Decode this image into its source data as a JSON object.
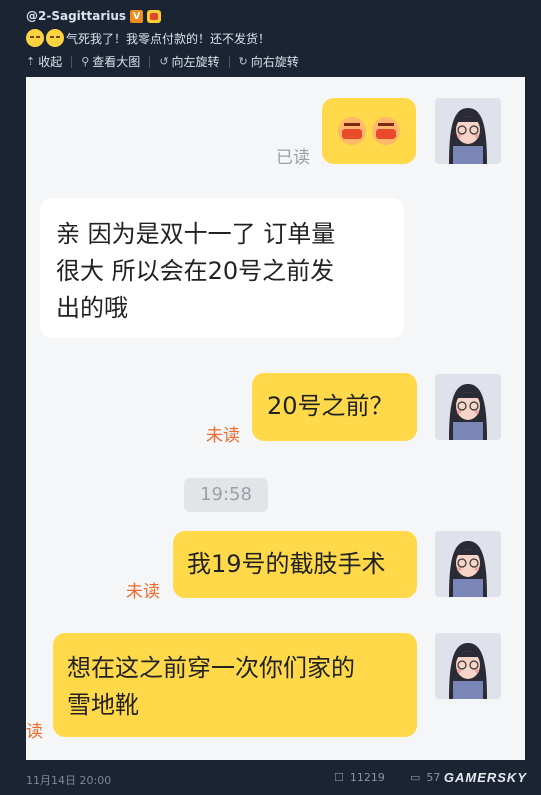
{
  "post": {
    "username": "@2-Sagittarius",
    "verified_badge": "V",
    "text": "气死我了！我零点付款的！还不发货！",
    "actions": [
      {
        "icon": "collapse-icon",
        "label": "收起"
      },
      {
        "icon": "magnify-icon",
        "label": "查看大图"
      },
      {
        "icon": "rotate-left-icon",
        "label": "向左旋转"
      },
      {
        "icon": "rotate-right-icon",
        "label": "向右旋转"
      }
    ]
  },
  "chat": {
    "messages": [
      {
        "side": "right",
        "text": "",
        "status": "已读",
        "content": "angry-emoji"
      },
      {
        "side": "left",
        "text": "亲 因为是双十一了  订单量很大  所以会在20号之前发出的哦"
      },
      {
        "side": "right",
        "text": "20号之前？",
        "status": "未读"
      },
      {
        "side": "right",
        "text": "我19号的截肢手术",
        "status": "未读"
      },
      {
        "side": "right",
        "text": "想在这之前穿一次你们家的雪地靴",
        "status": "读"
      }
    ],
    "time_divider": "19:58",
    "lines": {
      "m2_line1": "亲 因为是双十一了  订单量",
      "m2_line2": "很大   所以会在20号之前发",
      "m2_line3": "出的哦",
      "m5_line1": "想在这之前穿一次你们家的",
      "m5_line2": "雪地靴"
    }
  },
  "footer": {
    "date": "11月14日 20:00",
    "reposts": "11219",
    "comments": "57",
    "likes": "...",
    "watermark": "GAMERSKY"
  },
  "colors": {
    "page_bg": "#1b2433",
    "bubble_yellow": "#ffd94a",
    "unread_orange": "#f06a2b"
  }
}
